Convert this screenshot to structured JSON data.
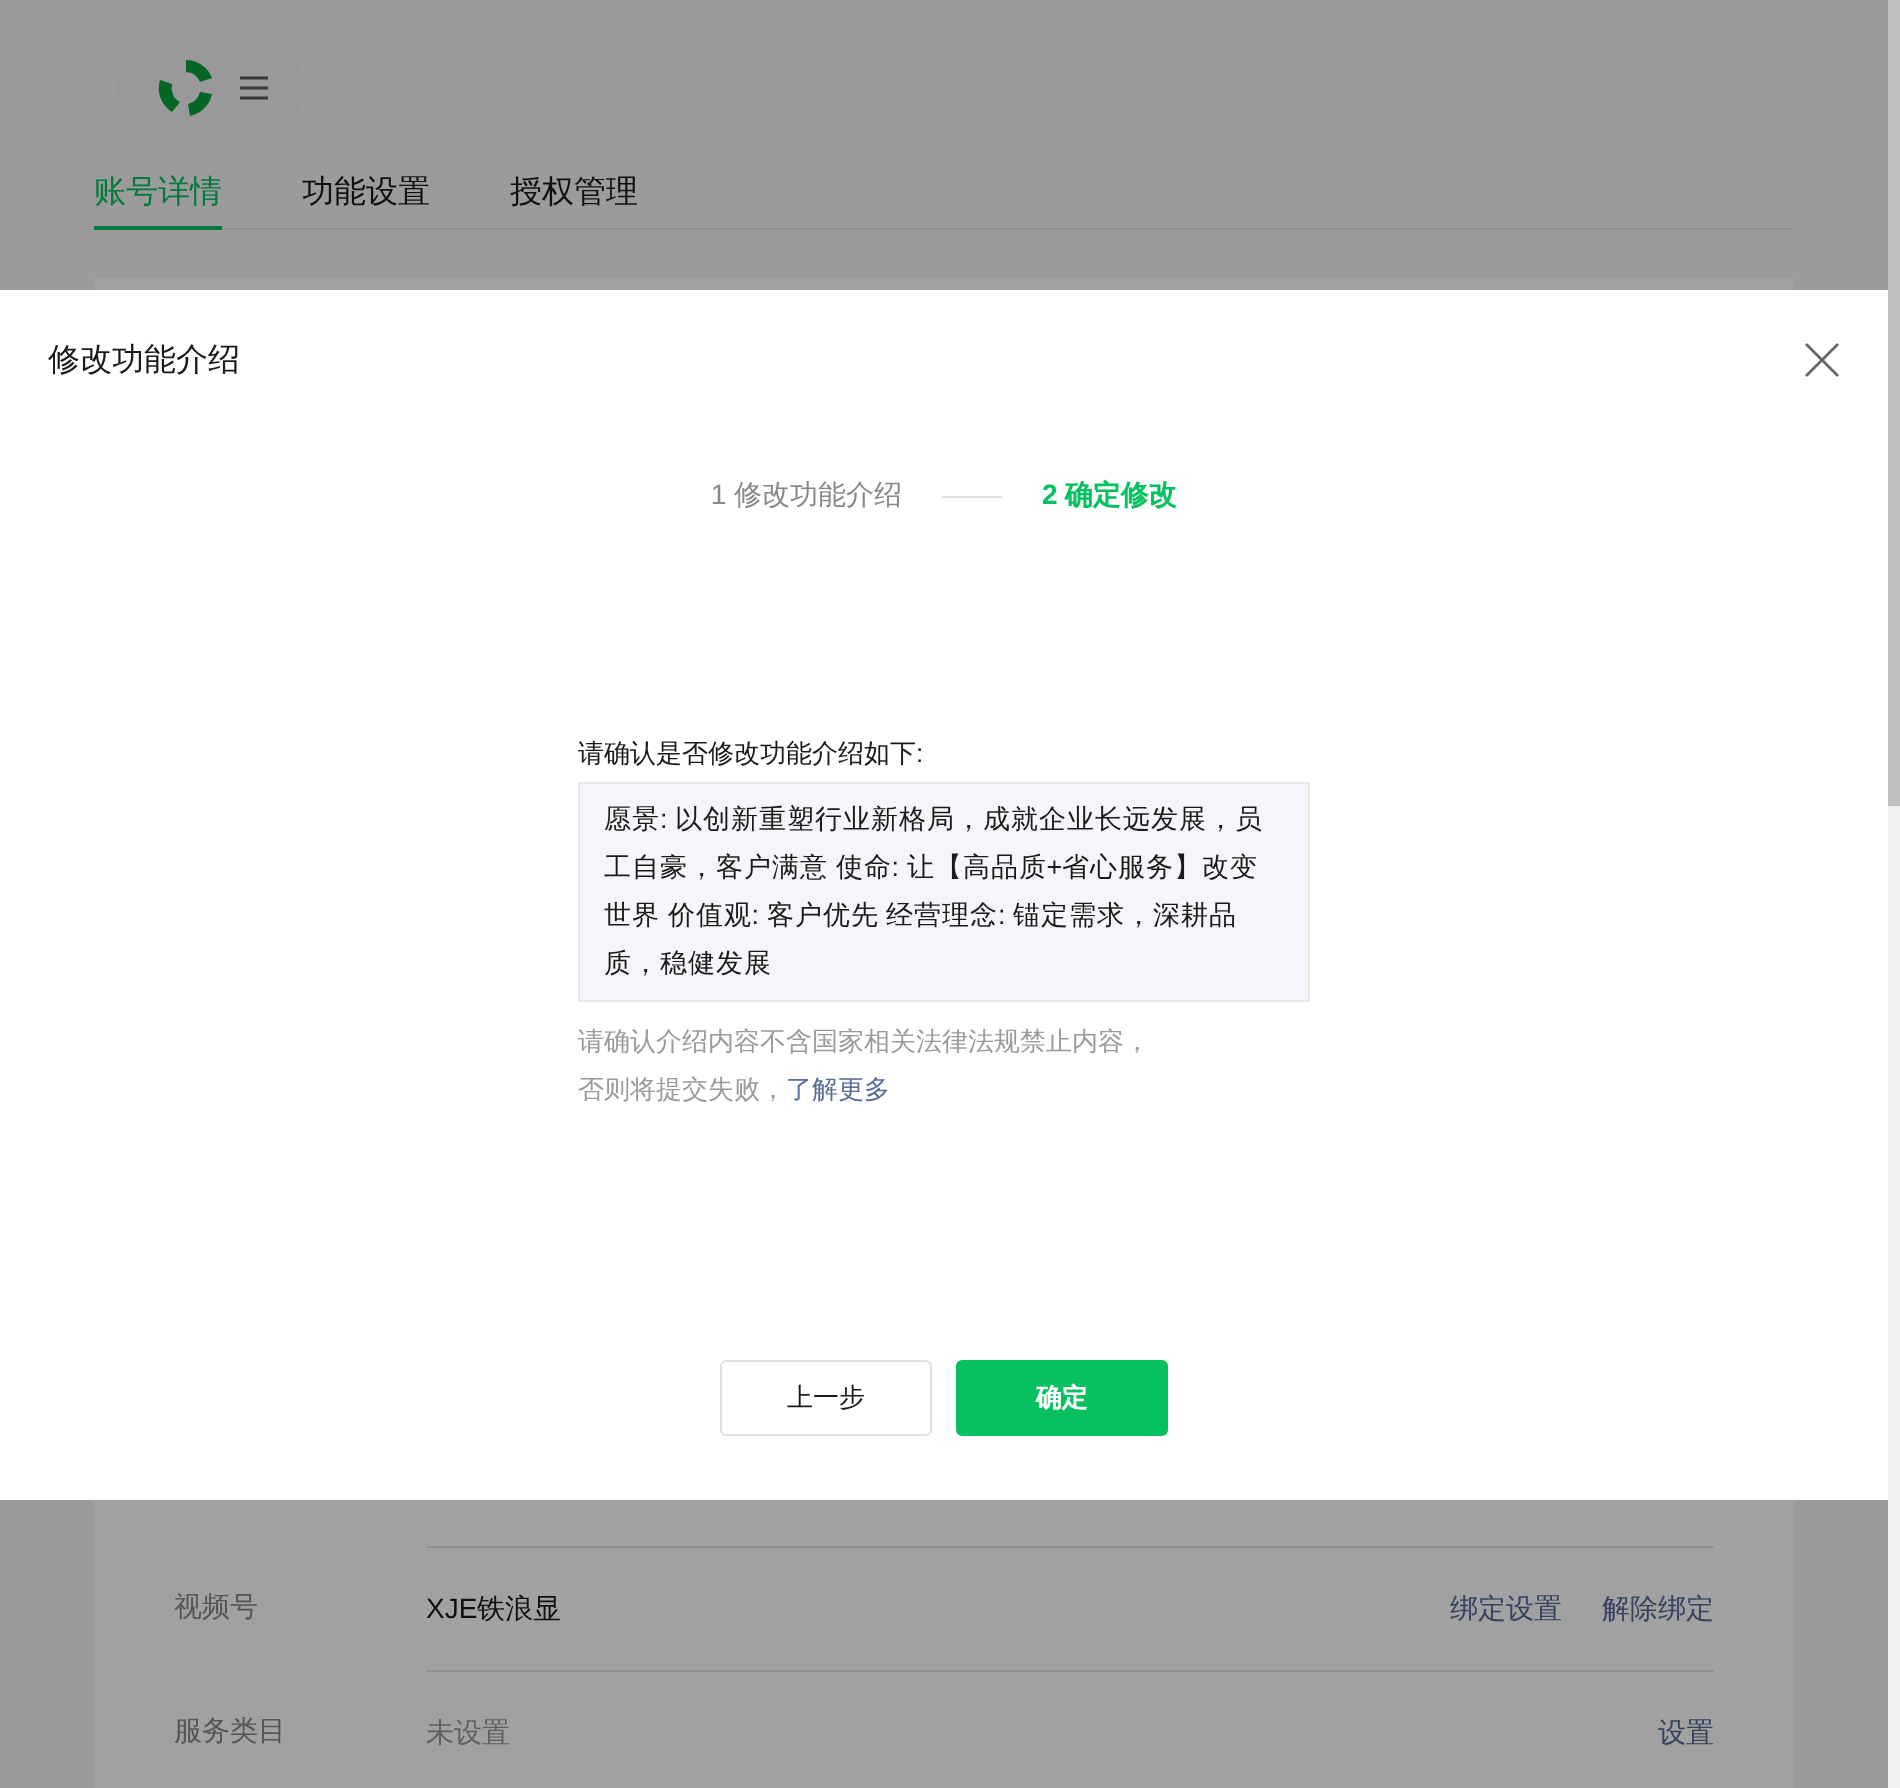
{
  "tabs": [
    {
      "label": "账号详情",
      "selected": true
    },
    {
      "label": "功能设置",
      "selected": false
    },
    {
      "label": "授权管理",
      "selected": false
    }
  ],
  "rows": [
    {
      "label": "视频号",
      "value": "XJE铁浪显",
      "unset": false,
      "actions": [
        "绑定设置",
        "解除绑定"
      ]
    },
    {
      "label": "服务类目",
      "value": "未设置",
      "unset": true,
      "actions": [
        "设置"
      ]
    }
  ],
  "dialog": {
    "title": "修改功能介绍",
    "steps": [
      {
        "number": "1",
        "label": "修改功能介绍",
        "selected": false
      },
      {
        "number": "2",
        "label": "确定修改",
        "selected": true
      }
    ],
    "prompt": "请确认是否修改功能介绍如下:",
    "content": "愿景: 以创新重塑行业新格局，成就企业长远发展，员工自豪，客户满意 使命: 让【高品质+省心服务】改变世界 价值观: 客户优先 经营理念: 锚定需求，深耕品质，稳健发展",
    "notice": "请确认介绍内容不含国家相关法律法规禁止内容，否则将提交失败，",
    "notice_link": "了解更多",
    "buttons": [
      {
        "label": "上一步",
        "kind": "secondary"
      },
      {
        "label": "确定",
        "kind": "primary"
      }
    ]
  }
}
